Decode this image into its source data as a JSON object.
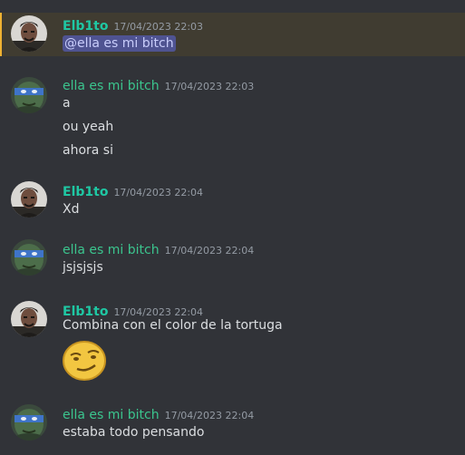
{
  "messages": [
    {
      "author": "Elb1to",
      "timestamp": "17/04/2023 22:03",
      "mention": "@ella es mi bitch"
    },
    {
      "author": "ella es mi bitch",
      "timestamp": "17/04/2023 22:03",
      "lines": [
        "a",
        "ou yeah",
        "ahora si"
      ]
    },
    {
      "author": "Elb1to",
      "timestamp": "17/04/2023 22:04",
      "lines": [
        "Xd"
      ]
    },
    {
      "author": "ella es mi bitch",
      "timestamp": "17/04/2023 22:04",
      "lines": [
        "jsjsjsjs"
      ]
    },
    {
      "author": "Elb1to",
      "timestamp": "17/04/2023 22:04",
      "lines": [
        "Combina con el color de la tortuga"
      ],
      "emoji": "smirk-face-emoji"
    },
    {
      "author": "ella es mi bitch",
      "timestamp": "17/04/2023 22:04",
      "lines": [
        "estaba todo pensando"
      ]
    }
  ],
  "colors": {
    "background": "#313338",
    "mention_highlight": "#403c31",
    "author_elb1to": "#1fc7a3",
    "author_ella": "#3bc58e",
    "timestamp": "#949ba4",
    "text": "#dbdee1"
  },
  "icons": {
    "elb1to_avatar": "person-photo-avatar",
    "ella_avatar": "turtle-ninja-avatar"
  }
}
